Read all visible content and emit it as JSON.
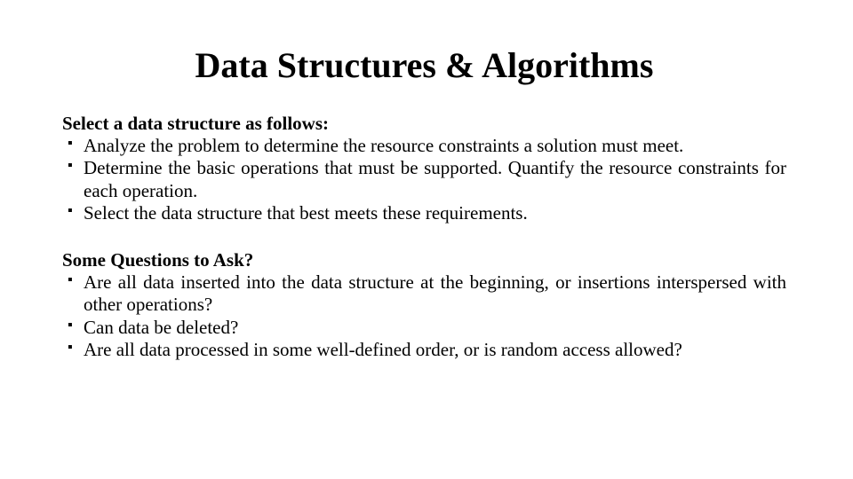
{
  "title": "Data Structures & Algorithms",
  "section1": {
    "heading": "Select a data structure as follows:",
    "items": [
      "Analyze the problem to determine the resource constraints a solution must meet.",
      "Determine the basic operations that must be supported. Quantify the resource constraints for each operation.",
      "Select the data structure that best meets these requirements."
    ]
  },
  "section2": {
    "heading": "Some Questions to Ask?",
    "items": [
      "Are all data inserted into the data structure at the beginning, or insertions interspersed with other operations?",
      "Can data be deleted?",
      "Are all data processed in some well-defined order, or is random access allowed?"
    ]
  }
}
